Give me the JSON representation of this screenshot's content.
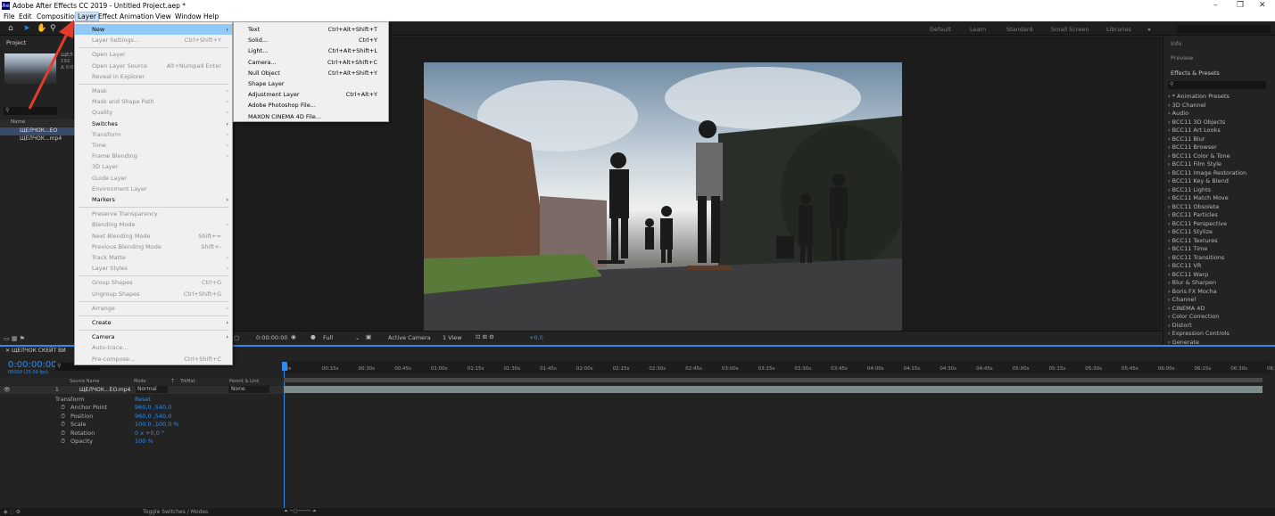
{
  "titlebar": {
    "title": "Adobe After Effects CC 2019 - Untitled Project.aep *"
  },
  "menubar": {
    "items": [
      "File",
      "Edit",
      "Composition",
      "Layer",
      "Effect",
      "Animation",
      "View",
      "Window",
      "Help"
    ]
  },
  "workspaces": [
    "Default",
    "Learn",
    "Standard",
    "Small Screen",
    "Libraries"
  ],
  "project": {
    "tab": "Project",
    "col_name": "Name",
    "items": [
      "ЩЕЛЧОК...EO",
      "ЩЕЛЧОК...mp4"
    ],
    "thumb_info": [
      "ЩЕЛ",
      "192",
      "Δ 0:0"
    ]
  },
  "layer_menu": [
    {
      "label": "New",
      "shortcut": "",
      "arrow": true,
      "state": "hl"
    },
    {
      "label": "Layer Settings...",
      "shortcut": "Ctrl+Shift+Y",
      "state": "dis"
    },
    {
      "sep": true
    },
    {
      "label": "Open Layer",
      "shortcut": "",
      "state": "dis"
    },
    {
      "label": "Open Layer Source",
      "shortcut": "Alt+Numpad Enter",
      "state": "dis"
    },
    {
      "label": "Reveal in Explorer",
      "shortcut": "",
      "state": "dis"
    },
    {
      "sep": true
    },
    {
      "label": "Mask",
      "arrow": true,
      "state": "dis"
    },
    {
      "label": "Mask and Shape Path",
      "arrow": true,
      "state": "dis"
    },
    {
      "label": "Quality",
      "arrow": true,
      "state": "dis"
    },
    {
      "label": "Switches",
      "arrow": true,
      "state": ""
    },
    {
      "label": "Transform",
      "arrow": true,
      "state": "dis"
    },
    {
      "label": "Time",
      "arrow": true,
      "state": "dis"
    },
    {
      "label": "Frame Blending",
      "arrow": true,
      "state": "dis"
    },
    {
      "label": "3D Layer",
      "state": "dis"
    },
    {
      "label": "Guide Layer",
      "state": "dis"
    },
    {
      "label": "Environment Layer",
      "state": "dis"
    },
    {
      "label": "Markers",
      "arrow": true,
      "state": ""
    },
    {
      "sep": true
    },
    {
      "label": "Preserve Transparency",
      "state": "dis"
    },
    {
      "label": "Blending Mode",
      "arrow": true,
      "state": "dis"
    },
    {
      "label": "Next Blending Mode",
      "shortcut": "Shift+=",
      "state": "dis"
    },
    {
      "label": "Previous Blending Mode",
      "shortcut": "Shift+-",
      "state": "dis"
    },
    {
      "label": "Track Matte",
      "arrow": true,
      "state": "dis"
    },
    {
      "label": "Layer Styles",
      "arrow": true,
      "state": "dis"
    },
    {
      "sep": true
    },
    {
      "label": "Group Shapes",
      "shortcut": "Ctrl+G",
      "state": "dis"
    },
    {
      "label": "Ungroup Shapes",
      "shortcut": "Ctrl+Shift+G",
      "state": "dis"
    },
    {
      "sep": true
    },
    {
      "label": "Arrange",
      "arrow": true,
      "state": "dis"
    },
    {
      "sep": true
    },
    {
      "label": "Create",
      "arrow": true,
      "state": ""
    },
    {
      "sep": true
    },
    {
      "label": "Camera",
      "arrow": true,
      "state": ""
    },
    {
      "label": "Auto-trace...",
      "state": "dis"
    },
    {
      "label": "Pre-compose...",
      "shortcut": "Ctrl+Shift+C",
      "state": "dis"
    }
  ],
  "new_menu": [
    {
      "label": "Text",
      "shortcut": "Ctrl+Alt+Shift+T"
    },
    {
      "label": "Solid...",
      "shortcut": "Ctrl+Y"
    },
    {
      "label": "Light...",
      "shortcut": "Ctrl+Alt+Shift+L"
    },
    {
      "label": "Camera...",
      "shortcut": "Ctrl+Alt+Shift+C"
    },
    {
      "label": "Null Object",
      "shortcut": "Ctrl+Alt+Shift+Y"
    },
    {
      "label": "Shape Layer",
      "shortcut": ""
    },
    {
      "label": "Adjustment Layer",
      "shortcut": "Ctrl+Alt+Y"
    },
    {
      "label": "Adobe Photoshop File...",
      "shortcut": ""
    },
    {
      "label": "MAXON CINEMA 4D File...",
      "shortcut": ""
    }
  ],
  "viewer_status": {
    "timecode": "0:00:00:00",
    "resolution": "Full",
    "camera": "Active Camera",
    "view": "1 View",
    "exposure": "+0,0"
  },
  "right_panel": {
    "info": "Info",
    "preview": "Preview",
    "effects_title": "Effects & Presets",
    "effects": [
      "* Animation Presets",
      "3D Channel",
      "Audio",
      "BCC11 3D Objects",
      "BCC11 Art Looks",
      "BCC11 Blur",
      "BCC11 Browser",
      "BCC11 Color & Tone",
      "BCC11 Film Style",
      "BCC11 Image Restoration",
      "BCC11 Key & Blend",
      "BCC11 Lights",
      "BCC11 Match Move",
      "BCC11 Obsolete",
      "BCC11 Particles",
      "BCC11 Perspective",
      "BCC11 Stylize",
      "BCC11 Textures",
      "BCC11 Time",
      "BCC11 Transitions",
      "BCC11 VR",
      "BCC11 Warp",
      "Blur & Sharpen",
      "Boris FX Mocha",
      "Channel",
      "CINEMA 4D",
      "Color Correction",
      "Distort",
      "Expression Controls",
      "Generate"
    ]
  },
  "timeline": {
    "comp_tab": "ЩЕЛЧОК СКЕЙТ ВИ",
    "timecode": "0:00:00:00",
    "frames": "00000 (25.00 fps)",
    "headers": [
      "Source Name",
      "Mode",
      "T",
      "TrkMat",
      "Parent & Link"
    ],
    "layer": {
      "num": "1",
      "name": "ЩЕЛЧОК...EO.mp4",
      "mode": "Normal",
      "parent": "None"
    },
    "transform": "Transform",
    "reset": "Reset",
    "props": [
      {
        "name": "Anchor Point",
        "value": "960,0 ,540,0"
      },
      {
        "name": "Position",
        "value": "960,0 ,540,0"
      },
      {
        "name": "Scale",
        "value": "100,0 ,100,0 %"
      },
      {
        "name": "Rotation",
        "value": "0 x +0,0 °"
      },
      {
        "name": "Opacity",
        "value": "100 %"
      }
    ],
    "ticks": [
      "0s",
      "00:15s",
      "00:30s",
      "00:45s",
      "01:00s",
      "01:15s",
      "01:30s",
      "01:45s",
      "02:00s",
      "02:15s",
      "02:30s",
      "02:45s",
      "03:00s",
      "03:15s",
      "03:30s",
      "03:45s",
      "04:00s",
      "04:15s",
      "04:30s",
      "04:45s",
      "05:00s",
      "05:15s",
      "05:30s",
      "05:45s",
      "06:00s",
      "06:15s",
      "06:30s",
      "06:45"
    ],
    "toggle": "Toggle Switches / Modes"
  }
}
